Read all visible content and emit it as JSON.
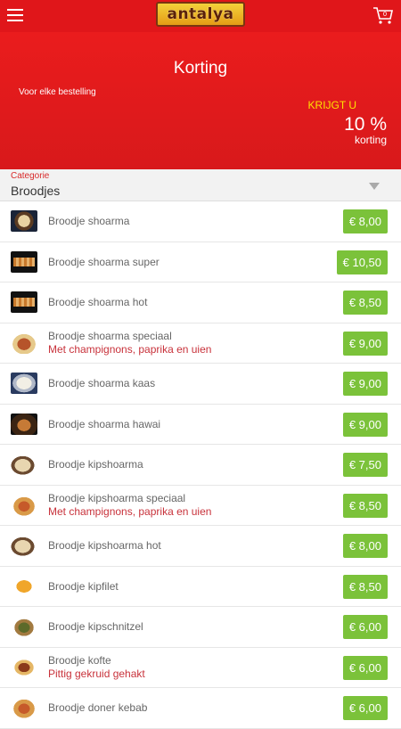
{
  "header": {
    "logo_text": "antalya",
    "cart_count": "0"
  },
  "hero": {
    "title": "Korting",
    "subtitle": "Voor elke bestelling",
    "krijgt": "KRIJGT U",
    "percentage": "10 %",
    "korting_label": "korting"
  },
  "category": {
    "label": "Categorie",
    "value": "Broodjes"
  },
  "items": [
    {
      "name": "Broodje shoarma",
      "desc": "",
      "price": "€ 8,00",
      "thumb": "t-plate"
    },
    {
      "name": "Broodje shoarma super",
      "desc": "",
      "price": "€ 10,50",
      "thumb": "t-tray"
    },
    {
      "name": "Broodje shoarma hot",
      "desc": "",
      "price": "€ 8,50",
      "thumb": "t-tray"
    },
    {
      "name": "Broodje shoarma speciaal",
      "desc": "Met champignons, paprika en uien",
      "price": "€ 9,00",
      "thumb": "t-wrap"
    },
    {
      "name": "Broodje shoarma kaas",
      "desc": "",
      "price": "€ 9,00",
      "thumb": "t-cheese"
    },
    {
      "name": "Broodje shoarma hawai",
      "desc": "",
      "price": "€ 9,00",
      "thumb": "t-dark"
    },
    {
      "name": "Broodje kipshoarma",
      "desc": "",
      "price": "€ 7,50",
      "thumb": "t-pita"
    },
    {
      "name": "Broodje kipshoarma speciaal",
      "desc": "Met champignons, paprika en uien",
      "price": "€ 8,50",
      "thumb": "t-pita2"
    },
    {
      "name": "Broodje kipshoarma hot",
      "desc": "",
      "price": "€ 8,00",
      "thumb": "t-pita"
    },
    {
      "name": "Broodje kipfilet",
      "desc": "",
      "price": "€ 8,50",
      "thumb": "t-fries"
    },
    {
      "name": "Broodje kipschnitzel",
      "desc": "",
      "price": "€ 6,00",
      "thumb": "t-burger"
    },
    {
      "name": "Broodje kofte",
      "desc": "Pittig gekruid gehakt",
      "price": "€ 6,00",
      "thumb": "t-kofte"
    },
    {
      "name": "Broodje doner kebab",
      "desc": "",
      "price": "€ 6,00",
      "thumb": "t-pita2"
    }
  ],
  "colors": {
    "brand_red": "#e0161a",
    "price_green": "#7bc23a",
    "desc_red": "#c8323b"
  }
}
